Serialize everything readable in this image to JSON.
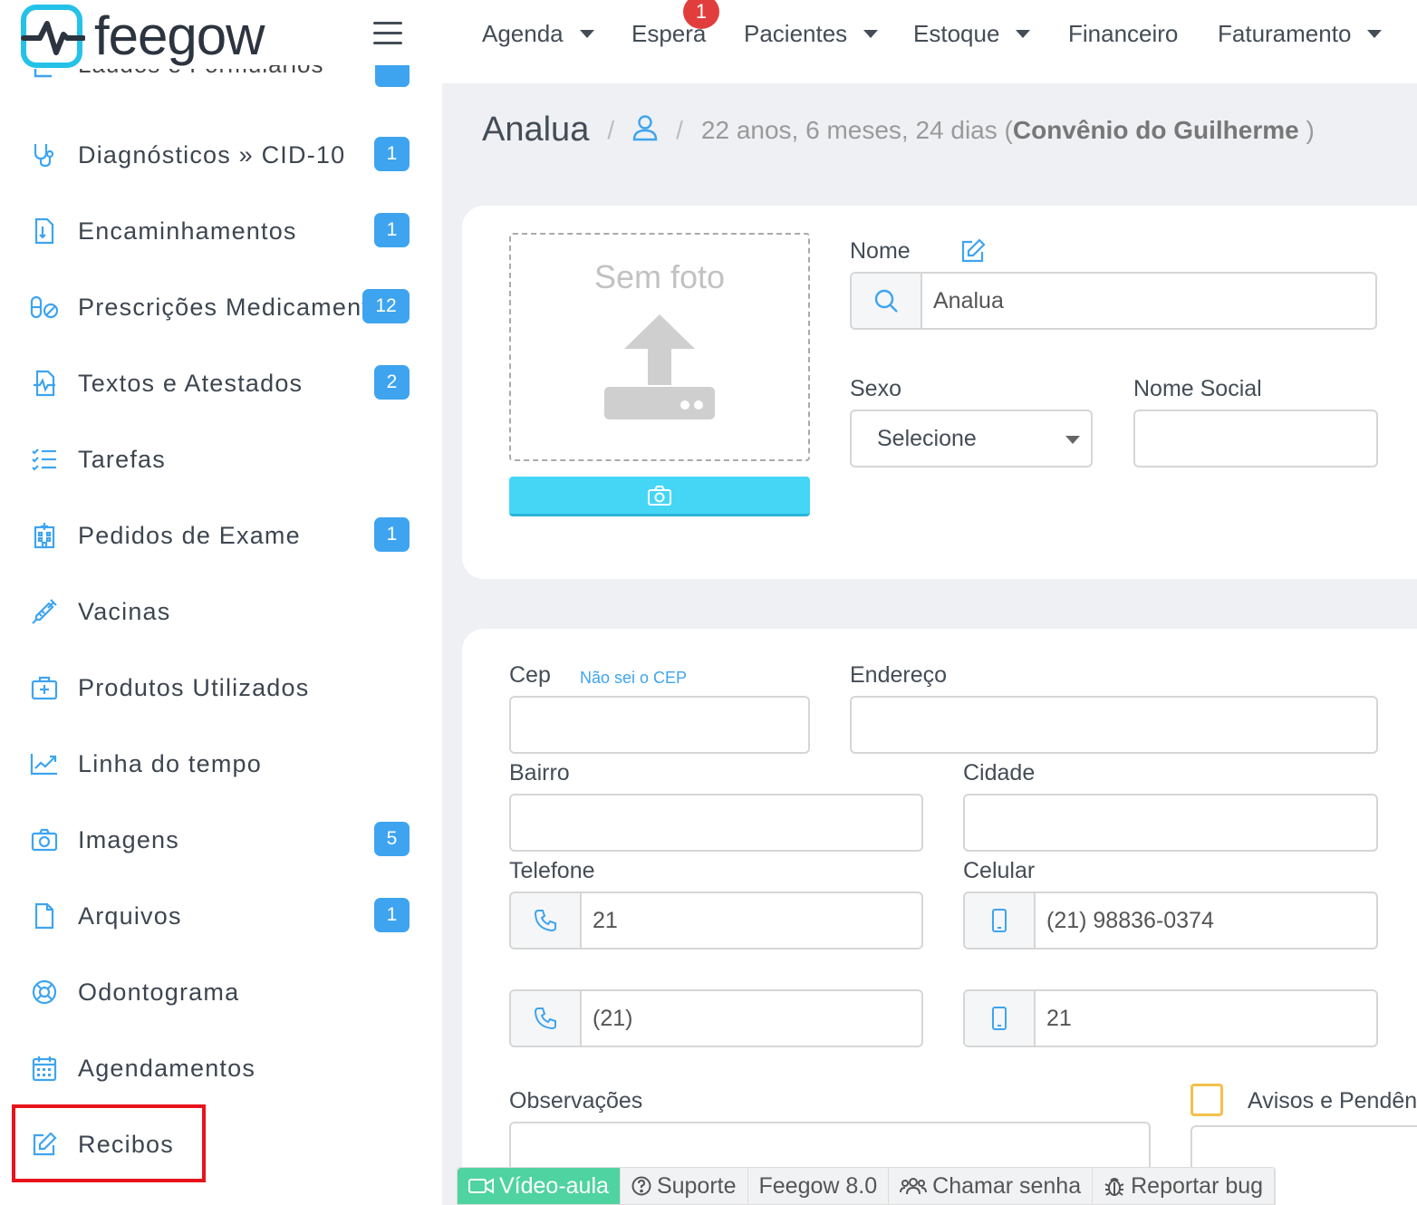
{
  "brand": {
    "name": "feegow",
    "accent": "#25c2e8"
  },
  "topnav": {
    "items": [
      {
        "label": "Agenda",
        "has_caret": true
      },
      {
        "label": "Espera",
        "has_caret": false,
        "notification": "1"
      },
      {
        "label": "Pacientes",
        "has_caret": true
      },
      {
        "label": "Estoque",
        "has_caret": true
      },
      {
        "label": "Financeiro",
        "has_caret": false
      },
      {
        "label": "Faturamento",
        "has_caret": true
      }
    ]
  },
  "sidebar": {
    "items": [
      {
        "label": "Diagnósticos » CID-10",
        "badge": "1",
        "icon": "stethoscope-icon"
      },
      {
        "label": "Encaminhamentos",
        "badge": "1",
        "icon": "document-icon"
      },
      {
        "label": "Prescrições Medicamentos",
        "badge": "12",
        "icon": "pills-icon"
      },
      {
        "label": "Textos e Atestados",
        "badge": "2",
        "icon": "file-pulse-icon"
      },
      {
        "label": "Tarefas",
        "badge": "",
        "icon": "checklist-icon"
      },
      {
        "label": "Pedidos de Exame",
        "badge": "1",
        "icon": "hospital-icon"
      },
      {
        "label": "Vacinas",
        "badge": "",
        "icon": "syringe-icon"
      },
      {
        "label": "Produtos Utilizados",
        "badge": "",
        "icon": "medkit-icon"
      },
      {
        "label": "Linha do tempo",
        "badge": "",
        "icon": "chart-line-icon"
      },
      {
        "label": "Imagens",
        "badge": "5",
        "icon": "camera-icon"
      },
      {
        "label": "Arquivos",
        "badge": "1",
        "icon": "file-icon"
      },
      {
        "label": "Odontograma",
        "badge": "",
        "icon": "lifebuoy-icon"
      },
      {
        "label": "Agendamentos",
        "badge": "",
        "icon": "calendar-icon"
      },
      {
        "label": "Recibos",
        "badge": "",
        "icon": "edit-icon"
      }
    ]
  },
  "breadcrumb": {
    "name": "Analua",
    "sep": "/",
    "age": "22 anos, 6 meses, 24 dias (",
    "plan": "Convênio do Guilherme",
    "close": " )"
  },
  "photo": {
    "placeholder": "Sem foto"
  },
  "form": {
    "nome_label": "Nome",
    "nome_value": "Analua",
    "sexo_label": "Sexo",
    "sexo_value": "Selecione",
    "nome_social_label": "Nome Social",
    "nome_social_value": "",
    "cep_label": "Cep",
    "cep_link": "Não sei o CEP",
    "cep_value": "",
    "endereco_label": "Endereço",
    "endereco_value": "",
    "bairro_label": "Bairro",
    "bairro_value": "",
    "cidade_label": "Cidade",
    "cidade_value": "",
    "telefone_label": "Telefone",
    "telefone_value": "21",
    "celular_label": "Celular",
    "celular_value": "(21) 98836-0374",
    "telefone2_value": "(21)",
    "celular2_value": "21",
    "observacoes_label": "Observações",
    "avisos_label": "Avisos e Pendências"
  },
  "footer": {
    "video": "Vídeo-aula",
    "suporte": "Suporte",
    "version": "Feegow 8.0",
    "chamar": "Chamar senha",
    "bug": "Reportar bug"
  }
}
